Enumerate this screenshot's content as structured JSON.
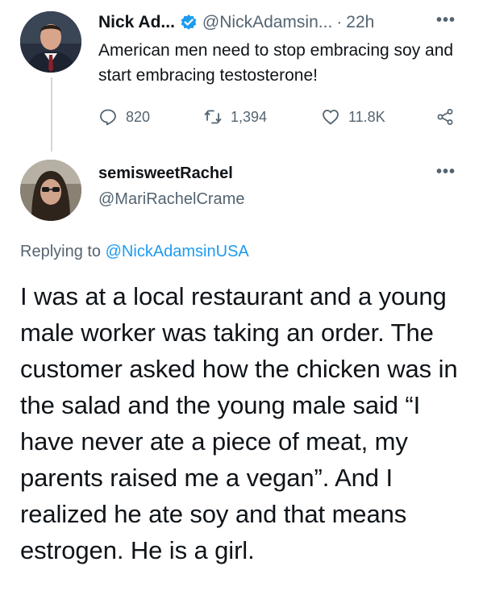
{
  "colors": {
    "text_primary": "#0f1419",
    "text_secondary": "#536471",
    "accent_blue": "#1d9bf0",
    "thread_line": "#cfd9de"
  },
  "tweet1": {
    "author_name": "Nick Ad...",
    "verified_icon": "verified-badge-icon",
    "handle": "@NickAdamsin...",
    "separator": "·",
    "time": "22h",
    "more_icon": "•••",
    "text": "American men need to stop embracing soy and start embracing testosterone!",
    "actions": {
      "reply_count": "820",
      "retweet_count": "1,394",
      "like_count": "11.8K",
      "reply_icon": "reply-icon",
      "retweet_icon": "retweet-icon",
      "like_icon": "heart-icon",
      "share_icon": "share-icon"
    }
  },
  "tweet2": {
    "author_name": "semisweetRachel",
    "handle": "@MariRachelCrame",
    "more_icon": "•••",
    "replying_prefix": "Replying to",
    "replying_mention": "@NickAdamsinUSA",
    "text": "I was at a local restaurant and a young male worker was taking an order. The customer asked how the chicken was in the salad and the young male said “I have never ate a piece of meat, my parents raised me a vegan”. And I realized he ate soy and that means estrogen. He is a girl."
  }
}
